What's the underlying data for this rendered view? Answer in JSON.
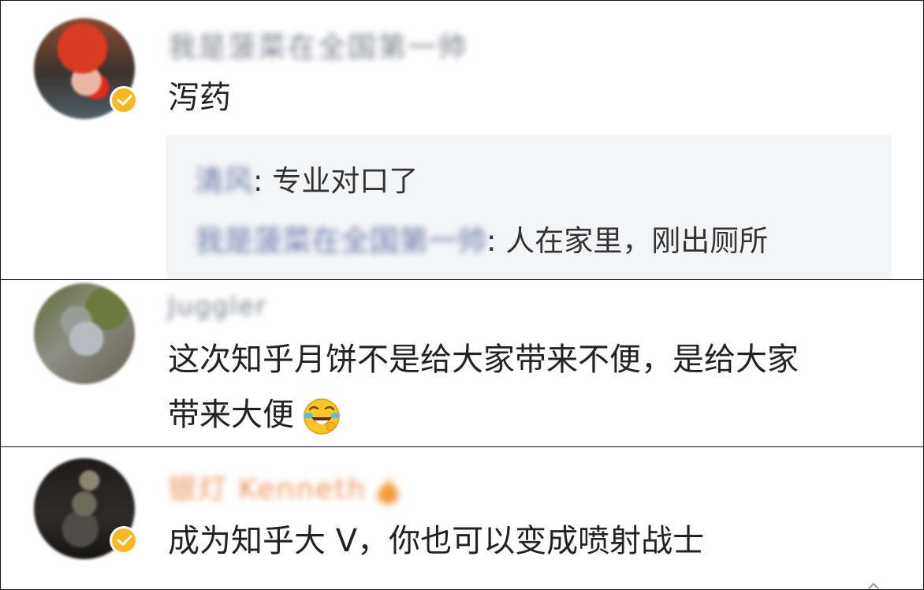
{
  "comments": [
    {
      "username": "我是菠菜在全国第一帅",
      "text": "泻药",
      "verified": true,
      "replies": [
        {
          "name": "清风",
          "text": ": 专业对口了"
        },
        {
          "name": "我是菠菜在全国第一帅",
          "text": ": 人在家里，刚出厕所"
        }
      ]
    },
    {
      "username": "Juggler",
      "text_line1": "这次知乎月饼不是给大家带来不便，是给大家",
      "text_line2": "带来大便",
      "emoji": "laughing-crying-emoji"
    },
    {
      "username": "银灯 Kenneth",
      "text": "成为知乎大 V，你也可以变成喷射战士",
      "verified": true,
      "name_icon": "flame-icon"
    }
  ],
  "colors": {
    "verified_badge": "#f7b824",
    "reply_background": "#f4f5f7",
    "username_gray": "#7b7f8a",
    "username_orange": "#e9935a",
    "reply_name": "#6b7aa8"
  }
}
